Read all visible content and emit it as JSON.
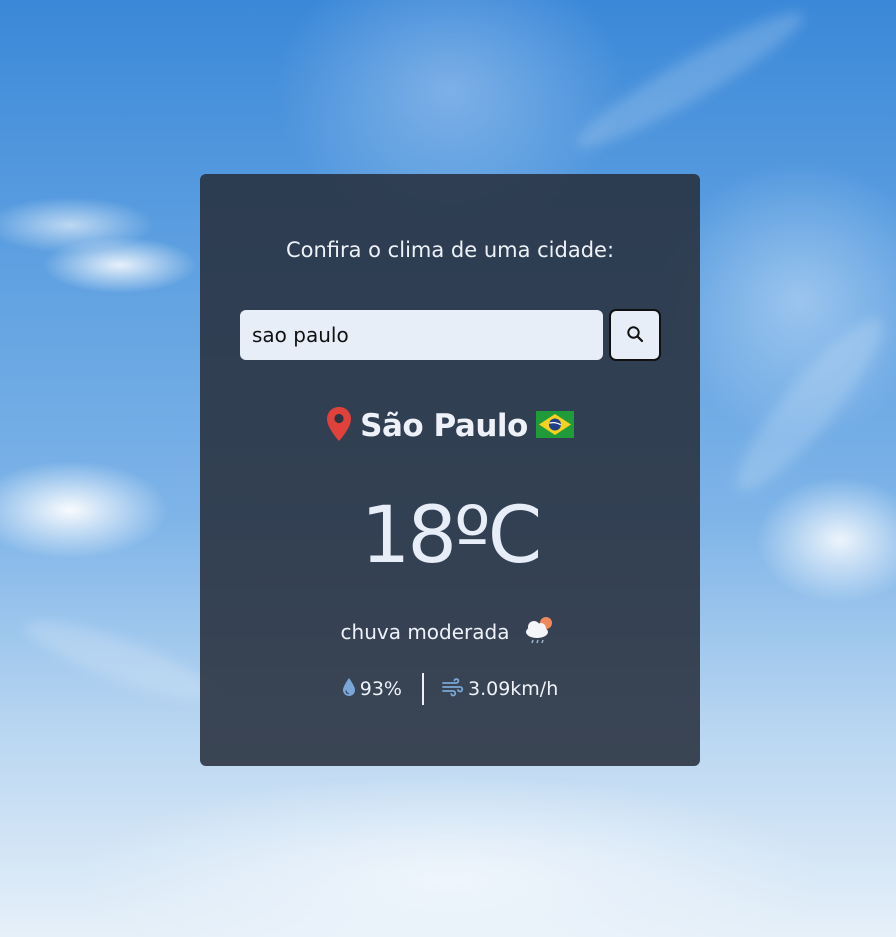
{
  "header": {
    "title": "Confira o clima de uma cidade:"
  },
  "search": {
    "value": "sao paulo",
    "button_icon": "search-icon"
  },
  "location": {
    "icon": "map-pin-icon",
    "city": "São Paulo",
    "flag": "brazil-flag"
  },
  "weather": {
    "temperature": "18ºC",
    "description": "chuva moderada",
    "description_icon": "cloud-rain-sun-icon"
  },
  "details": {
    "humidity_icon": "water-drop-icon",
    "humidity": "93%",
    "wind_icon": "wind-icon",
    "wind": "3.09km/h"
  },
  "colors": {
    "pin": "#e0413a",
    "card_background": "#28303e",
    "input_background": "#e8eef8",
    "detail_icon": "#7aa7d8"
  }
}
